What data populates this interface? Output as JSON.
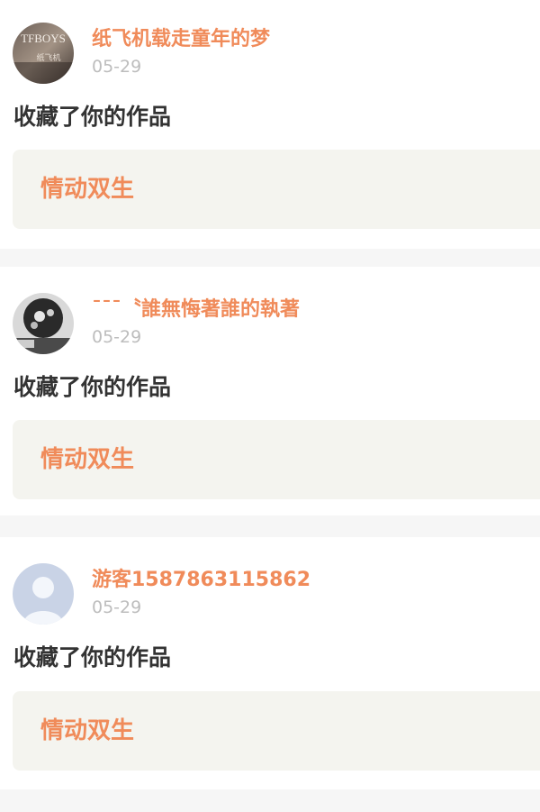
{
  "feed": {
    "items": [
      {
        "avatar": {
          "icon": "user-photo-avatar-icon",
          "overlay_text": "TFBOYS",
          "caption": "纸飞机"
        },
        "username": "纸飞机载走童年的梦",
        "date": "05-29",
        "action": "收藏了你的作品",
        "work_title": "情动双生"
      },
      {
        "avatar": {
          "icon": "user-photo-avatar-icon",
          "caption": ""
        },
        "username": "ˉˉˉ〝誰無悔著誰的執著",
        "date": "05-29",
        "action": "收藏了你的作品",
        "work_title": "情动双生"
      },
      {
        "avatar": {
          "icon": "default-user-avatar-icon"
        },
        "username": "游客1587863115862",
        "date": "05-29",
        "action": "收藏了你的作品",
        "work_title": "情动双生"
      }
    ]
  },
  "colors": {
    "accent": "#f08b5a",
    "text": "#333333",
    "muted": "#bdbdbd",
    "separator": "#f6f6f6",
    "work_box": "#f4f4ef"
  }
}
